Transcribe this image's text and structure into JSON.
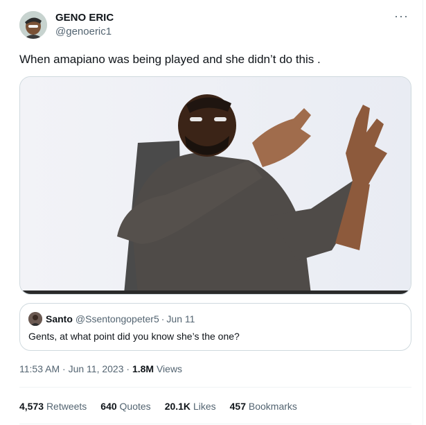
{
  "author": {
    "display_name": "GENO ERIC",
    "handle": "@genoeric1"
  },
  "more_icon": "more-horizontal-icon",
  "tweet": {
    "text": "When amapiano was being played and she didn’t do this ."
  },
  "quoted_tweet": {
    "name": "Santo",
    "handle": "@Ssentongopeter5",
    "separator": "·",
    "date": "Jun 11",
    "text": "Gents, at what point did you know she’s the one?"
  },
  "meta": {
    "time": "11:53 AM",
    "separator": "·",
    "date": "Jun 11, 2023",
    "views_count": "1.8M",
    "views_label": "Views"
  },
  "stats": {
    "retweets_count": "4,573",
    "retweets_label": "Retweets",
    "quotes_count": "640",
    "quotes_label": "Quotes",
    "likes_count": "20.1K",
    "likes_label": "Likes",
    "bookmarks_count": "457",
    "bookmarks_label": "Bookmarks"
  },
  "colors": {
    "text_primary": "#0f1419",
    "text_secondary": "#536471",
    "border": "#cfd9de"
  }
}
